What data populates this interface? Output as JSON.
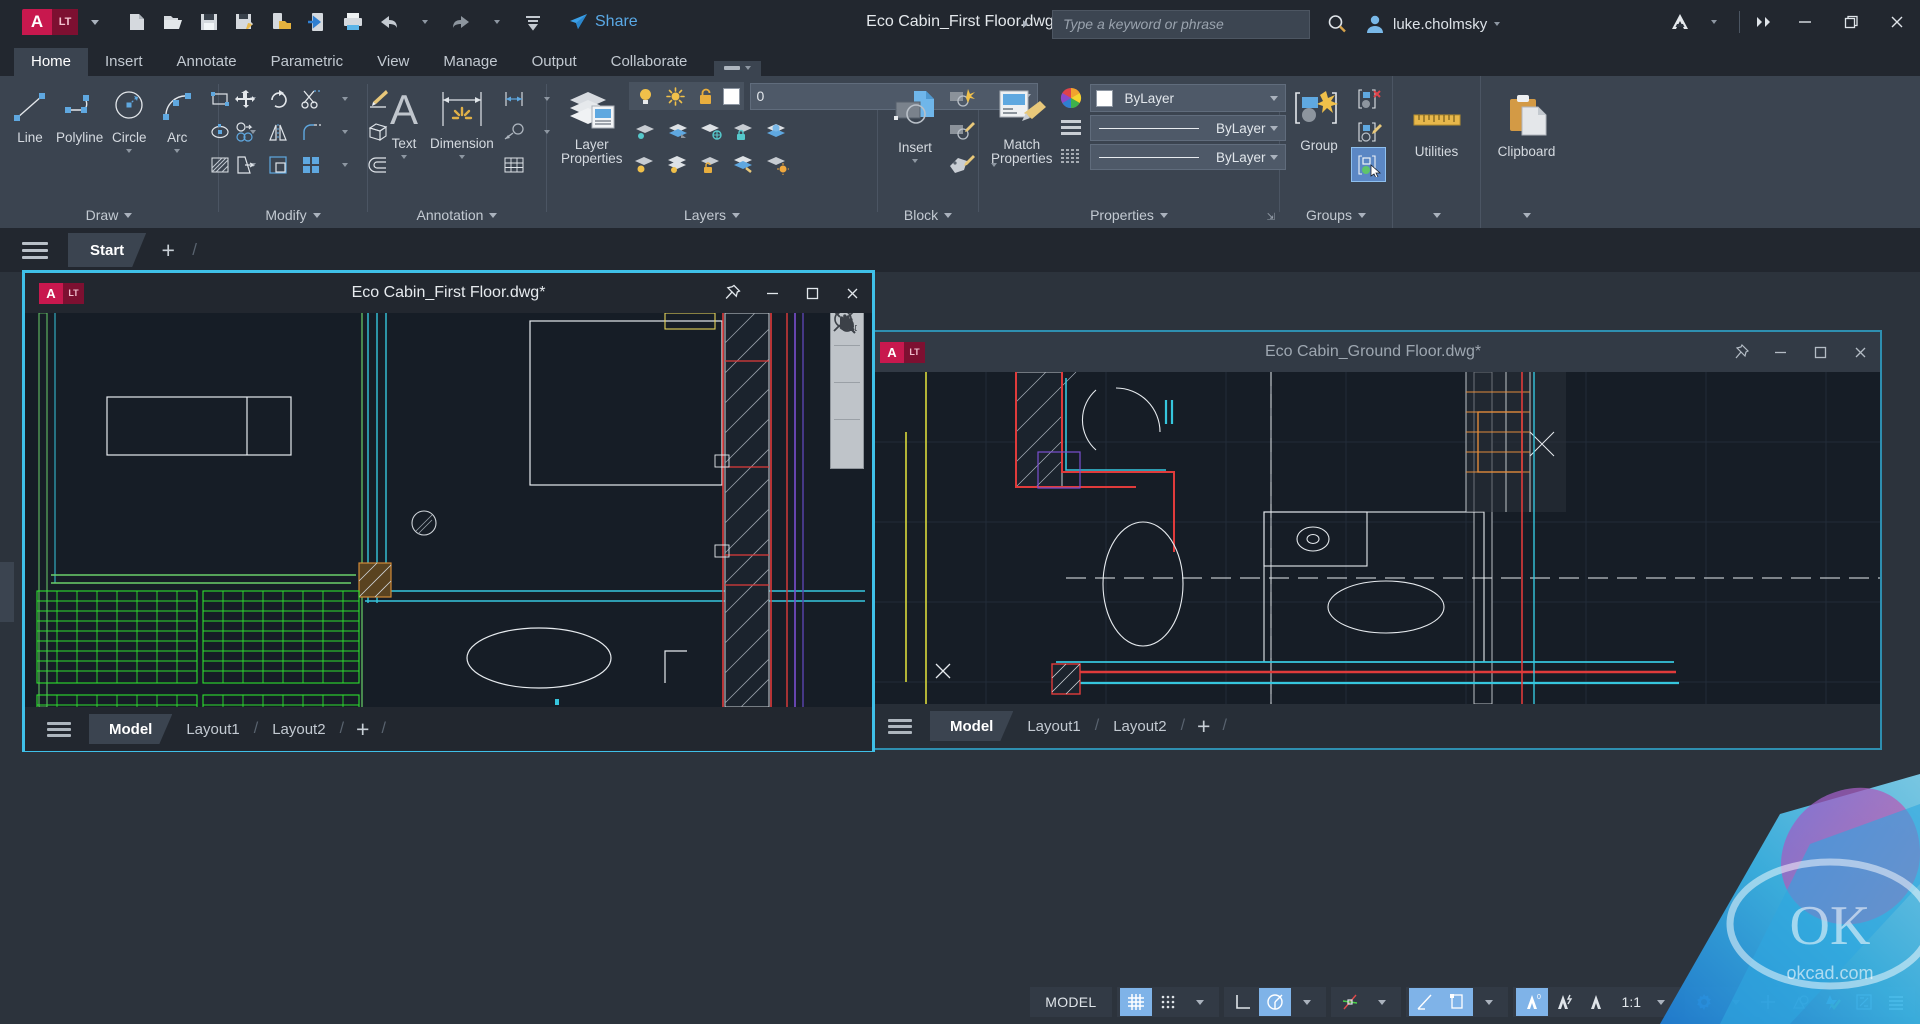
{
  "app": {
    "logo_a": "A",
    "logo_lt": "LT",
    "document_title": "Eco Cabin_First Floor.dwg",
    "share_label": "Share",
    "search_placeholder": "Type a keyword or phrase",
    "search_value": "",
    "username": "luke.cholmsky"
  },
  "quick_access": [
    {
      "name": "new-icon",
      "tip": "New"
    },
    {
      "name": "open-icon",
      "tip": "Open"
    },
    {
      "name": "save-icon",
      "tip": "Save"
    },
    {
      "name": "save-as-icon",
      "tip": "Save As"
    },
    {
      "name": "save-to-web-mobile-icon",
      "tip": "Save to Web & Mobile"
    },
    {
      "name": "open-from-web-mobile-icon",
      "tip": "Open from Web & Mobile"
    },
    {
      "name": "plot-icon",
      "tip": "Plot"
    },
    {
      "name": "undo-icon",
      "tip": "Undo"
    },
    {
      "name": "redo-icon",
      "tip": "Redo"
    },
    {
      "name": "customize-qat-icon",
      "tip": "Customize Quick Access Toolbar"
    }
  ],
  "ribbon": {
    "tabs": [
      {
        "label": "Home",
        "active": true
      },
      {
        "label": "Insert",
        "active": false
      },
      {
        "label": "Annotate",
        "active": false
      },
      {
        "label": "Parametric",
        "active": false
      },
      {
        "label": "View",
        "active": false
      },
      {
        "label": "Manage",
        "active": false
      },
      {
        "label": "Output",
        "active": false
      },
      {
        "label": "Collaborate",
        "active": false
      }
    ],
    "panels": {
      "draw": {
        "title": "Draw",
        "line": "Line",
        "polyline": "Polyline",
        "circle": "Circle",
        "arc": "Arc"
      },
      "modify": {
        "title": "Modify"
      },
      "annotation": {
        "title": "Annotation",
        "text": "Text",
        "dimension": "Dimension"
      },
      "layers": {
        "title": "Layers",
        "layer_properties": "Layer Properties",
        "current_layer": "0"
      },
      "block": {
        "title": "Block",
        "insert": "Insert"
      },
      "properties": {
        "title": "Properties",
        "match_properties": "Match Properties",
        "color": "ByLayer",
        "linetype": "ByLayer",
        "lineweight": "ByLayer"
      },
      "groups": {
        "title": "Groups",
        "group": "Group"
      },
      "utilities": {
        "title": "Utilities",
        "label": "Utilities"
      },
      "clipboard": {
        "title": "Clipboard",
        "label": "Clipboard"
      }
    }
  },
  "doc_tabs": {
    "menu_icon": "hamburger-menu-icon",
    "start_tab": "Start",
    "new_tab": "+"
  },
  "windows": [
    {
      "id": "first-floor",
      "title": "Eco Cabin_First Floor.dwg*",
      "active": true,
      "pinned": true,
      "layout_tabs": [
        "Model",
        "Layout1",
        "Layout2"
      ],
      "active_layout": "Model",
      "new_layout": "+",
      "controls": [
        "pin",
        "minimize",
        "maximize",
        "close"
      ]
    },
    {
      "id": "ground-floor",
      "title": "Eco Cabin_Ground Floor.dwg*",
      "active": false,
      "pinned": true,
      "layout_tabs": [
        "Model",
        "Layout1",
        "Layout2"
      ],
      "active_layout": "Model",
      "new_layout": "+",
      "controls": [
        "pin",
        "minimize",
        "maximize",
        "close"
      ]
    }
  ],
  "navbar": {
    "items": [
      "orbit-2d-icon",
      "pan-icon",
      "zoom-extents-icon",
      "navbar-more-icon"
    ]
  },
  "status_bar": {
    "space_label": "MODEL",
    "scale": "1:1",
    "toggles": [
      {
        "name": "grid-display",
        "on": true
      },
      {
        "name": "snap-mode",
        "on": false
      },
      {
        "name": "ortho-mode",
        "on": false
      },
      {
        "name": "polar-tracking",
        "on": true
      },
      {
        "name": "object-snap",
        "on": false
      },
      {
        "name": "object-snap-tracking",
        "on": true
      },
      {
        "name": "lineweight",
        "on": true
      },
      {
        "name": "annotation-visibility",
        "on": true
      },
      {
        "name": "annotation-autoscale",
        "on": false
      },
      {
        "name": "annotation-scale",
        "on": false
      },
      {
        "name": "workspace-switching",
        "on": false
      },
      {
        "name": "hardware-acceleration",
        "on": false
      },
      {
        "name": "isolate-objects",
        "on": false
      },
      {
        "name": "clean-screen",
        "on": false
      },
      {
        "name": "customization",
        "on": false
      }
    ]
  }
}
